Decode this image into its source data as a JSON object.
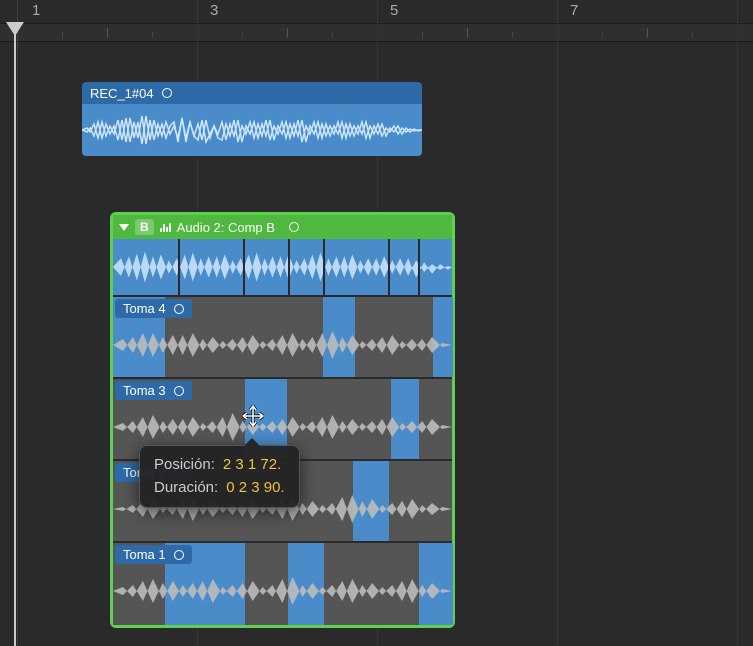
{
  "ruler": {
    "marks": [
      "1",
      "3",
      "5",
      "7"
    ]
  },
  "main_clip": {
    "name": "REC_1#04"
  },
  "folder": {
    "badge": "B",
    "title": "Audio 2: Comp B",
    "takes": [
      "Toma 4",
      "Toma 3",
      "Toma 2",
      "Toma 1"
    ]
  },
  "tooltip": {
    "position_label": "Posición:",
    "position_value": "2 3 1 72.",
    "duration_label": "Duración:",
    "duration_value": "0 2 3 90."
  }
}
